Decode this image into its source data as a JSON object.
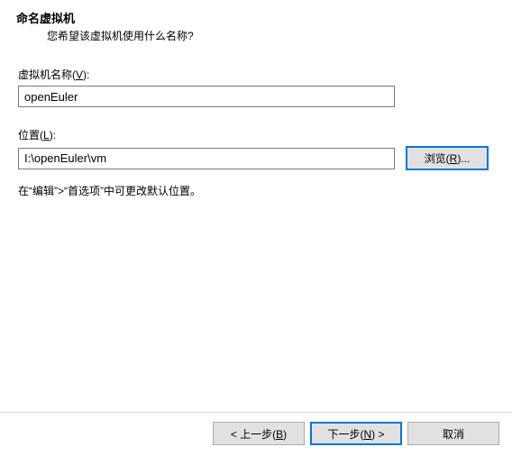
{
  "header": {
    "title": "命名虚拟机",
    "subtitle": "您希望该虚拟机使用什么名称?"
  },
  "name_field": {
    "label_pre": "虚拟机名称(",
    "label_hotkey": "V",
    "label_post": "):",
    "value": "openEuler"
  },
  "location_field": {
    "label_pre": "位置(",
    "label_hotkey": "L",
    "label_post": "):",
    "value": "I:\\openEuler\\vm"
  },
  "browse": {
    "label_pre": "浏览(",
    "label_hotkey": "R",
    "label_post": ")..."
  },
  "hint": "在“编辑”>“首选项”中可更改默认位置。",
  "footer": {
    "back_pre": "< 上一步(",
    "back_hotkey": "B",
    "back_post": ")",
    "next_pre": "下一步(",
    "next_hotkey": "N",
    "next_post": ") >",
    "cancel": "取消"
  }
}
